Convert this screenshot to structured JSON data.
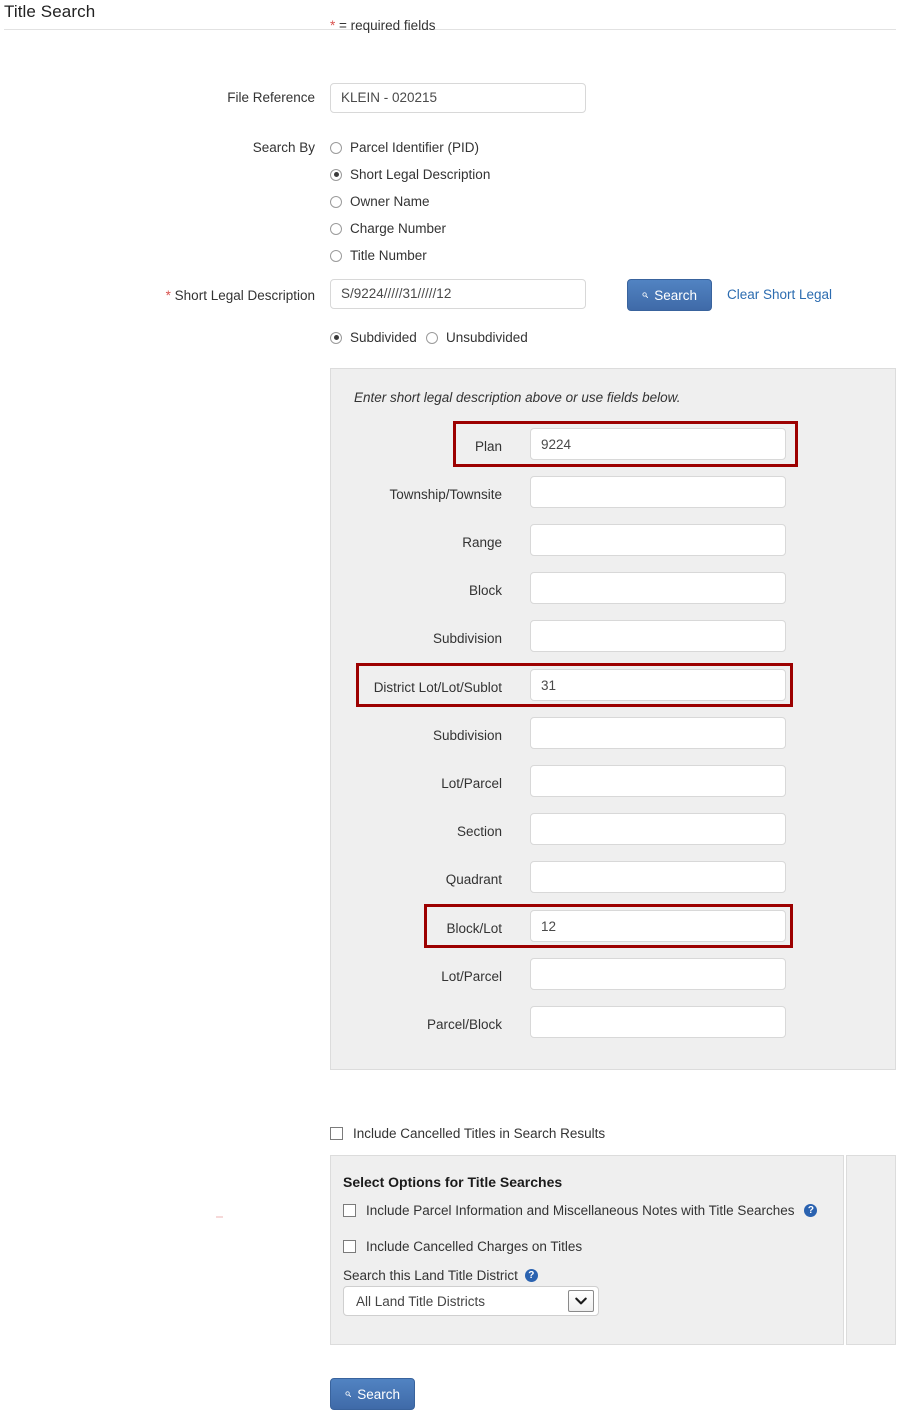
{
  "page": {
    "title": "Title Search",
    "required_note": "* = required fields",
    "required_marker": "*"
  },
  "file_reference": {
    "label": "File Reference",
    "value": "KLEIN - 020215",
    "placeholder": ""
  },
  "search_by": {
    "label": "Search By",
    "selected": "Short Legal Description",
    "options": [
      {
        "label": "Parcel Identifier (PID)",
        "checked": false
      },
      {
        "label": "Short Legal Description",
        "checked": true
      },
      {
        "label": "Owner Name",
        "checked": false
      },
      {
        "label": "Charge Number",
        "checked": false
      },
      {
        "label": "Title Number",
        "checked": false
      }
    ]
  },
  "short_legal": {
    "label": "Short Legal Description",
    "value": "S/9224/////31/////12",
    "search_button": "Search",
    "clear_link": "Clear Short Legal",
    "subdivision_options": [
      {
        "label": "Subdivided",
        "checked": true
      },
      {
        "label": "Unsubdivided",
        "checked": false
      }
    ]
  },
  "legal_panel": {
    "note": "Enter short legal description above or use fields below.",
    "fields": [
      {
        "label": "Plan",
        "value": "9224",
        "highlighted": true
      },
      {
        "label": "Township/Townsite",
        "value": "",
        "highlighted": false
      },
      {
        "label": "Range",
        "value": "",
        "highlighted": false
      },
      {
        "label": "Block",
        "value": "",
        "highlighted": false
      },
      {
        "label": "Subdivision",
        "value": "",
        "highlighted": false
      },
      {
        "label": "District Lot/Lot/Sublot",
        "value": "31",
        "highlighted": true
      },
      {
        "label": "Subdivision",
        "value": "",
        "highlighted": false
      },
      {
        "label": "Lot/Parcel",
        "value": "",
        "highlighted": false
      },
      {
        "label": "Section",
        "value": "",
        "highlighted": false
      },
      {
        "label": "Quadrant",
        "value": "",
        "highlighted": false
      },
      {
        "label": "Block/Lot",
        "value": "12",
        "highlighted": true
      },
      {
        "label": "Lot/Parcel",
        "value": "",
        "highlighted": false
      },
      {
        "label": "Parcel/Block",
        "value": "",
        "highlighted": false
      }
    ]
  },
  "include_cancelled_titles": {
    "label": "Include Cancelled Titles in Search Results",
    "checked": false
  },
  "options_panel": {
    "title": "Select Options for Title Searches",
    "checkbox_parcel_info": {
      "label": "Include Parcel Information and Miscellaneous Notes with Title Searches",
      "checked": false,
      "help": "?"
    },
    "checkbox_cancelled_charges": {
      "label": "Include Cancelled Charges on Titles",
      "checked": false
    },
    "district_label": "Search this Land Title District",
    "district_help": "?",
    "district_value": "All Land Title Districts",
    "district_options": [
      "All Land Title Districts"
    ]
  },
  "footer": {
    "search_button": "Search"
  },
  "colors": {
    "accent_blue": "#4472b0",
    "link_blue": "#2c6cb0",
    "highlight_red": "#9c0000",
    "required_star": "#d9534f",
    "panel_grey": "#efefef"
  }
}
